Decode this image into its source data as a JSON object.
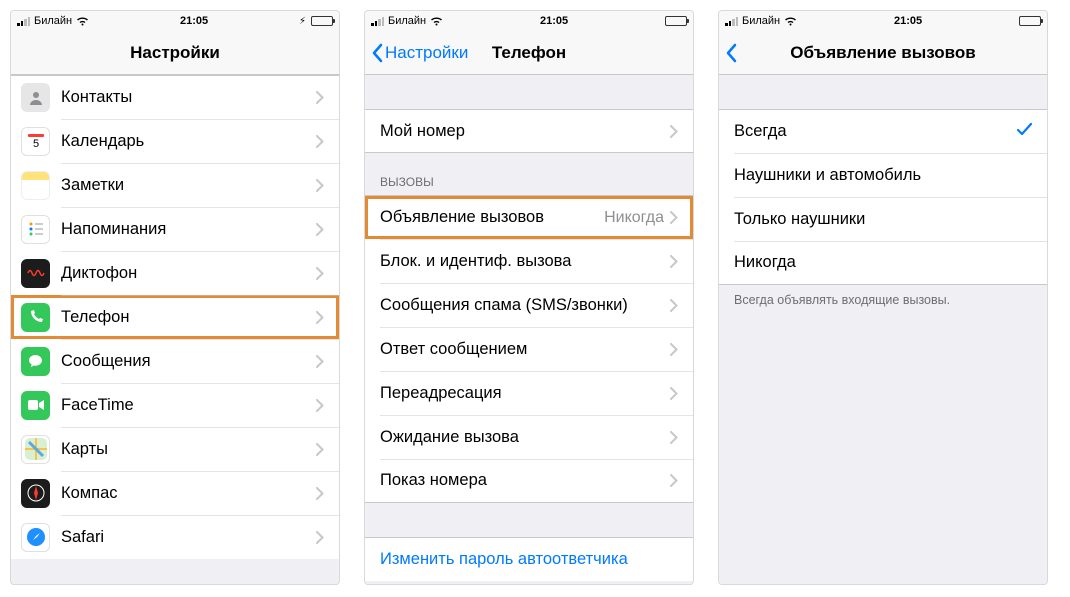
{
  "statusbar": {
    "carrier": "Билайн",
    "time": "21:05"
  },
  "screen1": {
    "title": "Настройки",
    "rows": [
      {
        "label": "Контакты"
      },
      {
        "label": "Календарь"
      },
      {
        "label": "Заметки"
      },
      {
        "label": "Напоминания"
      },
      {
        "label": "Диктофон"
      },
      {
        "label": "Телефон"
      },
      {
        "label": "Сообщения"
      },
      {
        "label": "FaceTime"
      },
      {
        "label": "Карты"
      },
      {
        "label": "Компас"
      },
      {
        "label": "Safari"
      }
    ]
  },
  "screen2": {
    "back": "Настройки",
    "title": "Телефон",
    "my_number": "Мой номер",
    "section_calls": "ВЫЗОВЫ",
    "rows": [
      {
        "label": "Объявление вызовов",
        "value": "Никогда"
      },
      {
        "label": "Блок. и идентиф. вызова"
      },
      {
        "label": "Сообщения спама (SMS/звонки)"
      },
      {
        "label": "Ответ сообщением"
      },
      {
        "label": "Переадресация"
      },
      {
        "label": "Ожидание вызова"
      },
      {
        "label": "Показ номера"
      }
    ],
    "voicemail_link": "Изменить пароль автоответчика"
  },
  "screen3": {
    "title": "Объявление вызовов",
    "options": [
      {
        "label": "Всегда",
        "selected": true
      },
      {
        "label": "Наушники и автомобиль"
      },
      {
        "label": "Только наушники"
      },
      {
        "label": "Никогда"
      }
    ],
    "footer": "Всегда объявлять входящие вызовы."
  },
  "showBolt": true
}
